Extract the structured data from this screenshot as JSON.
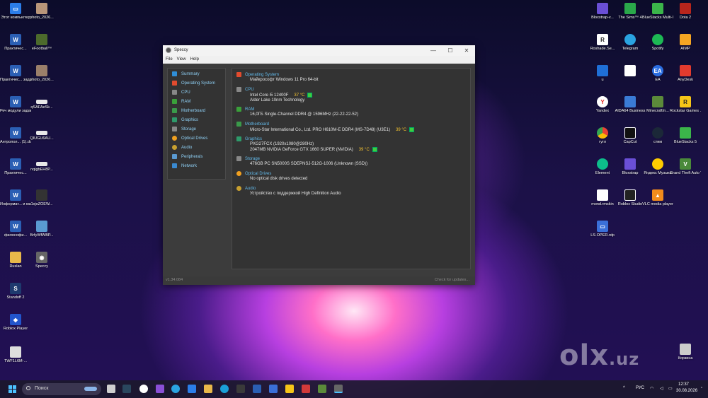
{
  "desktop_left": [
    {
      "label": "Этот компьютер",
      "color": "#2b7de9",
      "glyph": "▭",
      "pos": "a"
    },
    {
      "label": "Практичес...",
      "color": "#2b5fb4",
      "glyph": "W",
      "pos": "b"
    },
    {
      "label": "Практичес... задание.docx",
      "color": "#2b5fb4",
      "glyph": "W",
      "pos": "c"
    },
    {
      "label": "Реч модули задания 3к...",
      "color": "#2b5fb4",
      "glyph": "W",
      "pos": "d"
    },
    {
      "label": "Антропол... (1).docx",
      "color": "#2b5fb4",
      "glyph": "W",
      "pos": "e"
    },
    {
      "label": "Практичес...",
      "color": "#2b5fb4",
      "glyph": "W",
      "pos": "f"
    },
    {
      "label": "Информат... и математи...",
      "color": "#2b5fb4",
      "glyph": "W",
      "pos": "g"
    },
    {
      "label": "философи...",
      "color": "#2b5fb4",
      "glyph": "W",
      "pos": "h"
    },
    {
      "label": "Ruslan",
      "color": "#e8b84a",
      "glyph": "▬",
      "pos": "i"
    },
    {
      "label": "Standoff 2",
      "color": "#1e3a6e",
      "glyph": "S",
      "pos": "j"
    },
    {
      "label": "Roblox Player",
      "color": "#2255cc",
      "glyph": "◆",
      "pos": "k"
    },
    {
      "label": "TWF1L6M-...",
      "color": "#dddddd",
      "glyph": "▭",
      "pos": "l"
    }
  ],
  "desktop_left2": [
    {
      "label": "photo_2026...",
      "color": "#b9967a",
      "glyph": "",
      "pos": "a"
    },
    {
      "label": "eFootball™",
      "color": "#4c6a2c",
      "glyph": "",
      "pos": "b"
    },
    {
      "label": "photo_2026...",
      "color": "#9a7f6a",
      "glyph": "",
      "pos": "c"
    },
    {
      "label": "qSAFAeSk...",
      "color": "#e8e8e8",
      "glyph": "",
      "pos": "d"
    },
    {
      "label": "QIUGU6AU...",
      "color": "#e8e8e8",
      "glyph": "",
      "pos": "e"
    },
    {
      "label": "nqigbEH8P...",
      "color": "#e8e8e8",
      "glyph": "",
      "pos": "f"
    },
    {
      "label": "1xjoZOEW...",
      "color": "#333333",
      "glyph": "",
      "pos": "g"
    },
    {
      "label": "BrfyWfWBP...",
      "color": "#5a9ad1",
      "glyph": "",
      "pos": "h"
    },
    {
      "label": "Speccy",
      "color": "#666666",
      "glyph": "◉",
      "pos": "i"
    }
  ],
  "desktop_right": [
    {
      "label": "Bloxstrap-v...",
      "color": "#6a4fd6"
    },
    {
      "label": "The Sims™ 4",
      "color": "#2aa84a"
    },
    {
      "label": "BlueStacks Multi-Insta...",
      "color": "#3bb54a"
    },
    {
      "label": "Dota 2",
      "color": "#b8251c"
    },
    {
      "label": "Roshade.Se...",
      "color": "#ffffff"
    },
    {
      "label": "Telegram",
      "color": "#2aa3e0"
    },
    {
      "label": "Spotify",
      "color": "#1db954"
    },
    {
      "label": "AIMP",
      "color": "#f5a623"
    },
    {
      "label": "u",
      "color": "#1f6fd6"
    },
    {
      "label": "",
      "color": "#ffffff"
    },
    {
      "label": "EA",
      "color": "#2a6de0"
    },
    {
      "label": "AnyDesk",
      "color": "#e23b2e"
    },
    {
      "label": "Yandex",
      "color": "#ffffff"
    },
    {
      "label": "AIDA64 Business",
      "color": "#3a7bd5"
    },
    {
      "label": "MinecraftIn...",
      "color": "#5b8a3a"
    },
    {
      "label": "Rockstar Games ...",
      "color": "#f5c518"
    },
    {
      "label": "гугл",
      "color": "#4285f4"
    },
    {
      "label": "CapCut",
      "color": "#111111"
    },
    {
      "label": "стим",
      "color": "#1b2838"
    },
    {
      "label": "BlueStacks 5",
      "color": "#3bb54a"
    },
    {
      "label": "Element",
      "color": "#0dbd8b"
    },
    {
      "label": "Bloxstrap",
      "color": "#6a4fd6"
    },
    {
      "label": "Яндекс Музыка",
      "color": "#ffcc00"
    },
    {
      "label": "Grand Theft Auto V En...",
      "color": "#4a8a3a"
    },
    {
      "label": "mond.rmskin",
      "color": "#ffffff"
    },
    {
      "label": "Roblox Studio",
      "color": "#222222"
    },
    {
      "label": "VLC media player",
      "color": "#f28c1c"
    },
    {
      "label": "",
      "color": "#000000"
    },
    {
      "label": "LS-OPER.rdp",
      "color": "#3a6fd8"
    },
    {
      "label": "Корзина",
      "color": "#cccccc"
    }
  ],
  "window": {
    "title": "Speccy",
    "minimize": "—",
    "maximize": "☐",
    "close": "✕",
    "menu": [
      "File",
      "View",
      "Help"
    ],
    "nav": [
      {
        "label": "Summary",
        "color": "#2f8fd8"
      },
      {
        "label": "Operating System",
        "color": "#e24b2e"
      },
      {
        "label": "CPU",
        "color": "#888888"
      },
      {
        "label": "RAM",
        "color": "#3aa03a"
      },
      {
        "label": "Motherboard",
        "color": "#3a9a4a"
      },
      {
        "label": "Graphics",
        "color": "#2e9a6a"
      },
      {
        "label": "Storage",
        "color": "#888888"
      },
      {
        "label": "Optical Drives",
        "color": "#f0a020"
      },
      {
        "label": "Audio",
        "color": "#c8a030"
      },
      {
        "label": "Peripherals",
        "color": "#5a9ad1"
      },
      {
        "label": "Network",
        "color": "#3a8ad1"
      }
    ],
    "sections": {
      "os": {
        "title": "Operating System",
        "lines": [
          "Майкрософт Windows 11 Pro 64-bit"
        ]
      },
      "cpu": {
        "title": "CPU",
        "line1": "Intel Core i5 12400F",
        "temp": "37 °C",
        "line2": "Alder Lake 10nm Technology"
      },
      "ram": {
        "title": "RAM",
        "lines": [
          "16,0ГБ Single-Channel DDR4 @ 1596MHz (22-22-22-52)"
        ]
      },
      "mb": {
        "title": "Motherboard",
        "line1": "Micro-Star International Co., Ltd. PRO H610M-E DDR4 (MS-7D48) (U3E1)",
        "temp": "39 °C"
      },
      "gpu": {
        "title": "Graphics",
        "line1": "PXG27FCX (1920x1080@280Hz)",
        "line2": "2047MB NVIDIA GeForce GTX 1660 SUPER (NVIDIA)",
        "temp": "39 °C"
      },
      "storage": {
        "title": "Storage",
        "lines": [
          "476GB PC SN5000S SDEPNSJ-512G-1006 (Unknown (SSD))"
        ]
      },
      "optical": {
        "title": "Optical Drives",
        "lines": [
          "No optical disk drives detected"
        ]
      },
      "audio": {
        "title": "Audio",
        "lines": [
          "Устройство с поддержкой High Definition Audio"
        ]
      }
    },
    "version": "v1.34.084",
    "check_updates": "Check for updates..."
  },
  "taskbar": {
    "search_placeholder": "Поиск",
    "language": "РУС",
    "time": "12:37",
    "date": "30.08.2026"
  },
  "watermark": {
    "main": "olx",
    "suffix": ".uz"
  }
}
